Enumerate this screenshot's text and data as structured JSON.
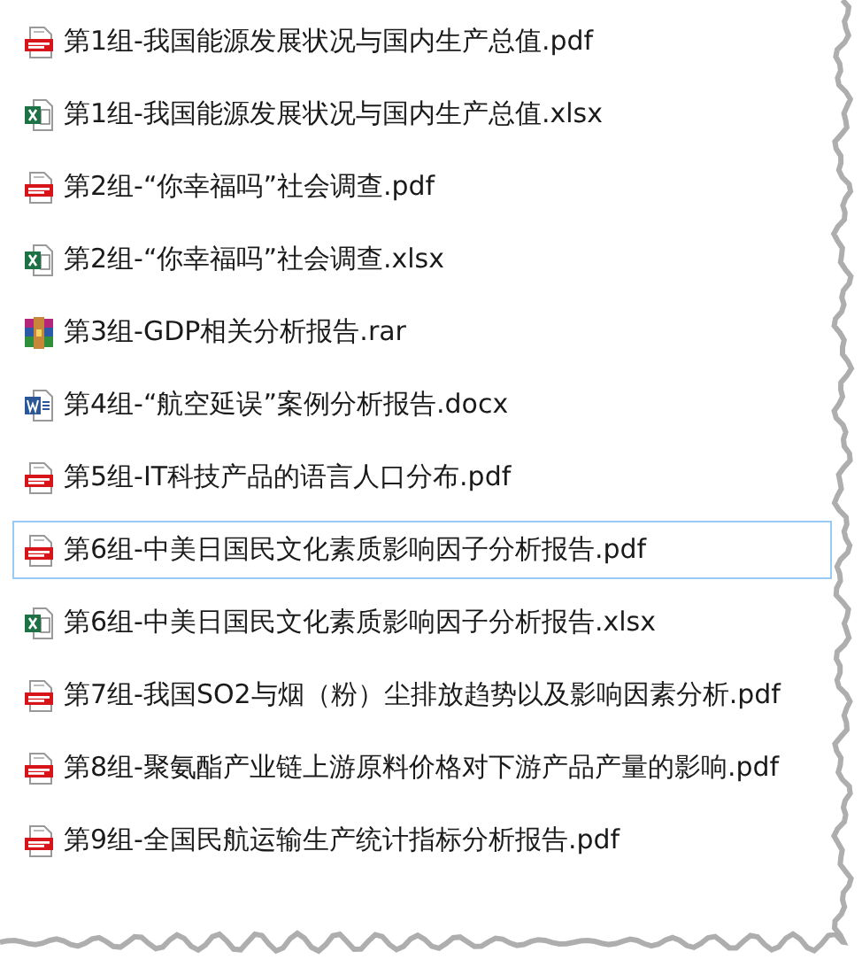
{
  "files": [
    {
      "name": "第1组-我国能源发展状况与国内生产总值.pdf",
      "kind": "pdf",
      "selected": false
    },
    {
      "name": "第1组-我国能源发展状况与国内生产总值.xlsx",
      "kind": "xlsx",
      "selected": false
    },
    {
      "name": "第2组-“你幸福吗”社会调查.pdf",
      "kind": "pdf",
      "selected": false
    },
    {
      "name": "第2组-“你幸福吗”社会调查.xlsx",
      "kind": "xlsx",
      "selected": false
    },
    {
      "name": "第3组-GDP相关分析报告.rar",
      "kind": "rar",
      "selected": false
    },
    {
      "name": "第4组-“航空延误”案例分析报告.docx",
      "kind": "docx",
      "selected": false
    },
    {
      "name": "第5组-IT科技产品的语言人口分布.pdf",
      "kind": "pdf",
      "selected": false
    },
    {
      "name": "第6组-中美日国民文化素质影响因子分析报告.pdf",
      "kind": "pdf",
      "selected": true
    },
    {
      "name": "第6组-中美日国民文化素质影响因子分析报告.xlsx",
      "kind": "xlsx",
      "selected": false
    },
    {
      "name": "第7组-我国SO2与烟（粉）尘排放趋势以及影响因素分析.pdf",
      "kind": "pdf",
      "selected": false
    },
    {
      "name": "第8组-聚氨酯产业链上游原料价格对下游产品产量的影响.pdf",
      "kind": "pdf",
      "selected": false
    },
    {
      "name": "第9组-全国民航运输生产统计指标分析报告.pdf",
      "kind": "pdf",
      "selected": false
    }
  ]
}
